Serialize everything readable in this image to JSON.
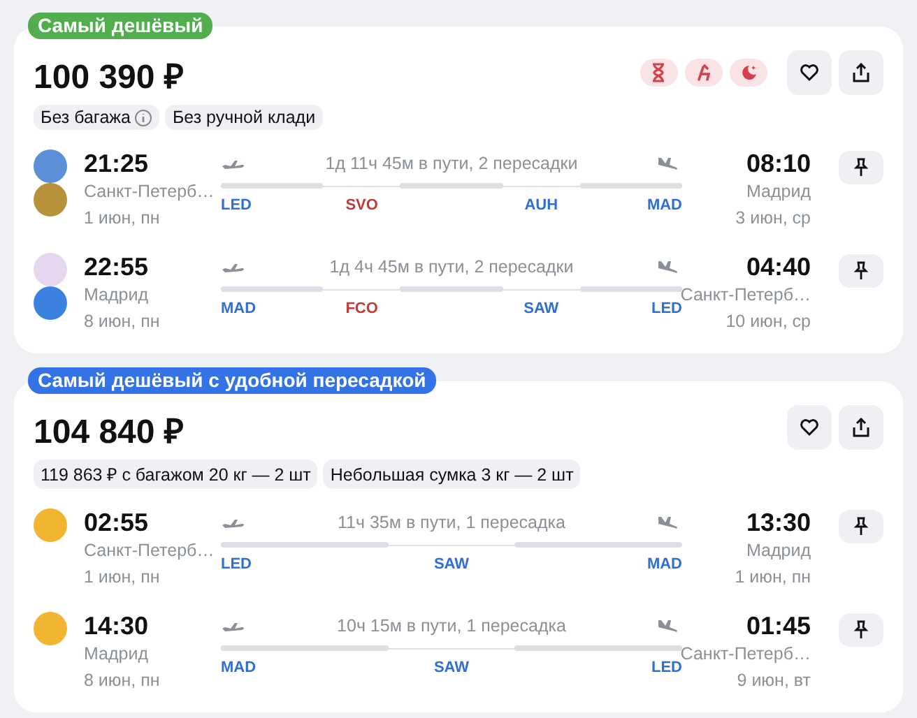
{
  "offers": [
    {
      "badge": {
        "text": "Самый дешёвый",
        "color": "#52ad4f"
      },
      "price": "100 390 ₽",
      "warnings": [
        {
          "kind": "hourglass"
        },
        {
          "kind": "seat"
        },
        {
          "kind": "night"
        }
      ],
      "tags": [
        {
          "text": "Без багажа",
          "info": true
        },
        {
          "text": "Без ручной клади",
          "info": false
        }
      ],
      "legs": [
        {
          "carriers": [
            {
              "color": "#5b8fd8"
            },
            {
              "color": "#b8923a"
            }
          ],
          "depart_time": "21:25",
          "depart_city": "Санкт-Петерб…",
          "depart_date": "1 июн, пн",
          "duration": "1д 11ч 45м в пути, 2 пересадки",
          "airports": [
            {
              "code": "LED",
              "color": "#2f6fd6"
            },
            {
              "code": "SVO",
              "color": "#c23b3b"
            },
            {
              "code": "AUH",
              "color": "#2f6fd6"
            },
            {
              "code": "MAD",
              "color": "#2f6fd6"
            }
          ],
          "arrive_time": "08:10",
          "arrive_city": "Мадрид",
          "arrive_date": "3 июн, ср"
        },
        {
          "carriers": [
            {
              "color": "#e7d6f0"
            },
            {
              "color": "#3b82e0"
            }
          ],
          "depart_time": "22:55",
          "depart_city": "Мадрид",
          "depart_date": "8 июн, пн",
          "duration": "1д 4ч 45м в пути, 2 пересадки",
          "airports": [
            {
              "code": "MAD",
              "color": "#2f6fd6"
            },
            {
              "code": "FCO",
              "color": "#c23b3b"
            },
            {
              "code": "SAW",
              "color": "#2f6fd6"
            },
            {
              "code": "LED",
              "color": "#2f6fd6"
            }
          ],
          "arrive_time": "04:40",
          "arrive_city": "Санкт-Петерб…",
          "arrive_date": "10 июн, ср"
        }
      ]
    },
    {
      "badge": {
        "text": "Самый дешёвый с удобной пересадкой",
        "color": "#3373e6"
      },
      "price": "104 840 ₽",
      "tags": [
        {
          "text": "119 863 ₽ с багажом 20 кг — 2 шт",
          "info": false
        },
        {
          "text": "Небольшая сумка 3 кг — 2 шт",
          "info": false
        }
      ],
      "legs": [
        {
          "carriers": [
            {
              "color": "#f2b531"
            }
          ],
          "depart_time": "02:55",
          "depart_city": "Санкт-Петерб…",
          "depart_date": "1 июн, пн",
          "duration": "11ч 35м в пути, 1 пересадка",
          "airports": [
            {
              "code": "LED",
              "color": "#2f6fd6"
            },
            {
              "code": "SAW",
              "color": "#2f6fd6"
            },
            {
              "code": "MAD",
              "color": "#2f6fd6"
            }
          ],
          "arrive_time": "13:30",
          "arrive_city": "Мадрид",
          "arrive_date": "1 июн, пн"
        },
        {
          "carriers": [
            {
              "color": "#f2b531"
            }
          ],
          "depart_time": "14:30",
          "depart_city": "Мадрид",
          "depart_date": "8 июн, пн",
          "duration": "10ч 15м в пути, 1 пересадка",
          "airports": [
            {
              "code": "MAD",
              "color": "#2f6fd6"
            },
            {
              "code": "SAW",
              "color": "#2f6fd6"
            },
            {
              "code": "LED",
              "color": "#2f6fd6"
            }
          ],
          "arrive_time": "01:45",
          "arrive_city": "Санкт-Петерб…",
          "arrive_date": "9 июн, вт"
        }
      ]
    }
  ]
}
